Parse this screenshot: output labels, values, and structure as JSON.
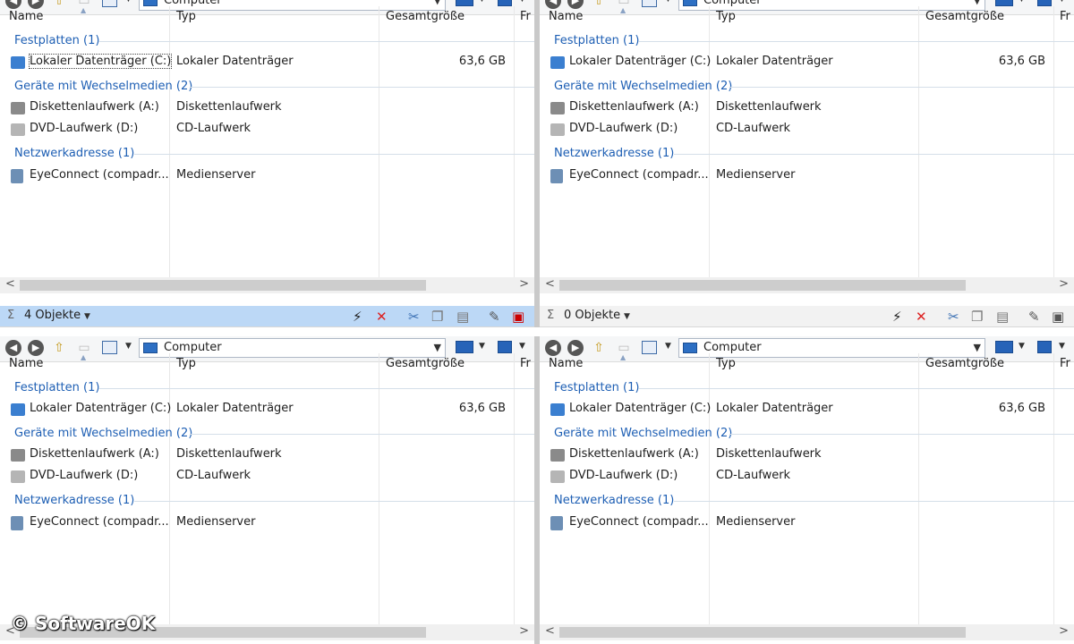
{
  "toolbar": {
    "address": "Computer"
  },
  "columns": [
    "Name",
    "Typ",
    "Gesamtgröße",
    "Fr"
  ],
  "groups": {
    "drives": "Festplatten (1)",
    "removable": "Geräte mit Wechselmedien (2)",
    "network": "Netzwerkadresse (1)"
  },
  "rows": [
    {
      "name": "Lokaler Datenträger (C:)",
      "type": "Lokaler Datenträger",
      "size": "63,6 GB",
      "icon": "hard-drive-icon"
    },
    {
      "name": "Diskettenlaufwerk (A:)",
      "type": "Diskettenlaufwerk",
      "size": "",
      "icon": "floppy-drive-icon"
    },
    {
      "name": "DVD-Laufwerk (D:)",
      "type": "CD-Laufwerk",
      "size": "",
      "icon": "dvd-drive-icon"
    },
    {
      "name": "EyeConnect (compadr...",
      "type": "Medienserver",
      "size": "",
      "icon": "media-server-icon"
    }
  ],
  "status": {
    "left_count": "4 Objekte",
    "right_count": "0 Objekte"
  },
  "watermark": "© SoftwareOK",
  "colors": {
    "accent_blue": "#1e5fb4",
    "active_status": "#bcd8f6",
    "inactive_status": "#f2f2f2"
  }
}
